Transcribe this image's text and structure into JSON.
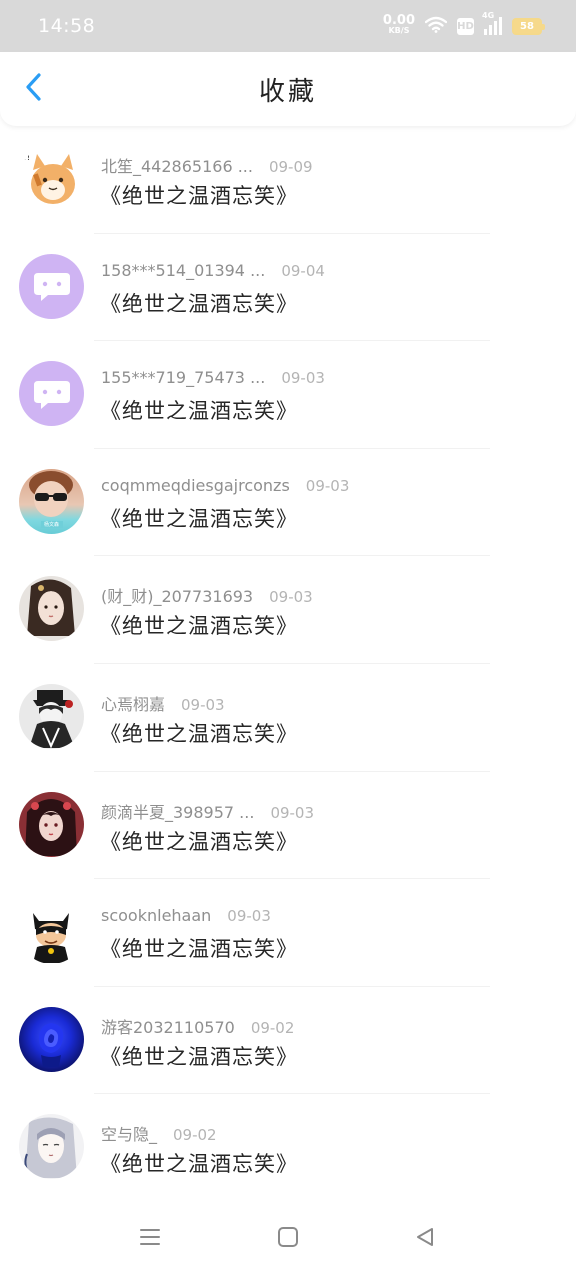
{
  "status_bar": {
    "time": "14:58",
    "net_speed": "0.00",
    "net_unit": "KB/S",
    "hd_label": "HD",
    "network_type": "4G",
    "battery": "58"
  },
  "header": {
    "title": "收藏",
    "back_icon": "chevron-left-icon",
    "accent_color": "#2a9df4"
  },
  "favorites": [
    {
      "name": "北笙_442865166 ...",
      "date": "09-09",
      "title": "《绝世之温酒忘笑》",
      "avatar": "cartoon-cat"
    },
    {
      "name": "158***514_01394 ...",
      "date": "09-04",
      "title": "《绝世之温酒忘笑》",
      "avatar": "default-chat"
    },
    {
      "name": "155***719_75473 ...",
      "date": "09-03",
      "title": "《绝世之温酒忘笑》",
      "avatar": "default-chat"
    },
    {
      "name": "coqmmeqdiesgajrconzs",
      "date": "09-03",
      "title": "《绝世之温酒忘笑》",
      "avatar": "person-sunglasses"
    },
    {
      "name": "(财_财)_207731693",
      "date": "09-03",
      "title": "《绝世之温酒忘笑》",
      "avatar": "anime-girl"
    },
    {
      "name": "心焉栩嘉",
      "date": "09-03",
      "title": "《绝世之温酒忘笑》",
      "avatar": "anime-boy-bw"
    },
    {
      "name": "颜滴半夏_398957 ...",
      "date": "09-03",
      "title": "《绝世之温酒忘笑》",
      "avatar": "anime-red"
    },
    {
      "name": "scooknlehaan",
      "date": "09-03",
      "title": "《绝世之温酒忘笑》",
      "avatar": "batman"
    },
    {
      "name": "游客2032110570",
      "date": "09-02",
      "title": "《绝世之温酒忘笑》",
      "avatar": "blue-rose"
    },
    {
      "name": "空与隐_",
      "date": "09-02",
      "title": "《绝世之温酒忘笑》",
      "avatar": "ink-portrait"
    }
  ],
  "nav_bar": {
    "menu_icon": "menu-icon",
    "home_icon": "home-square-icon",
    "back_icon": "back-triangle-icon"
  }
}
